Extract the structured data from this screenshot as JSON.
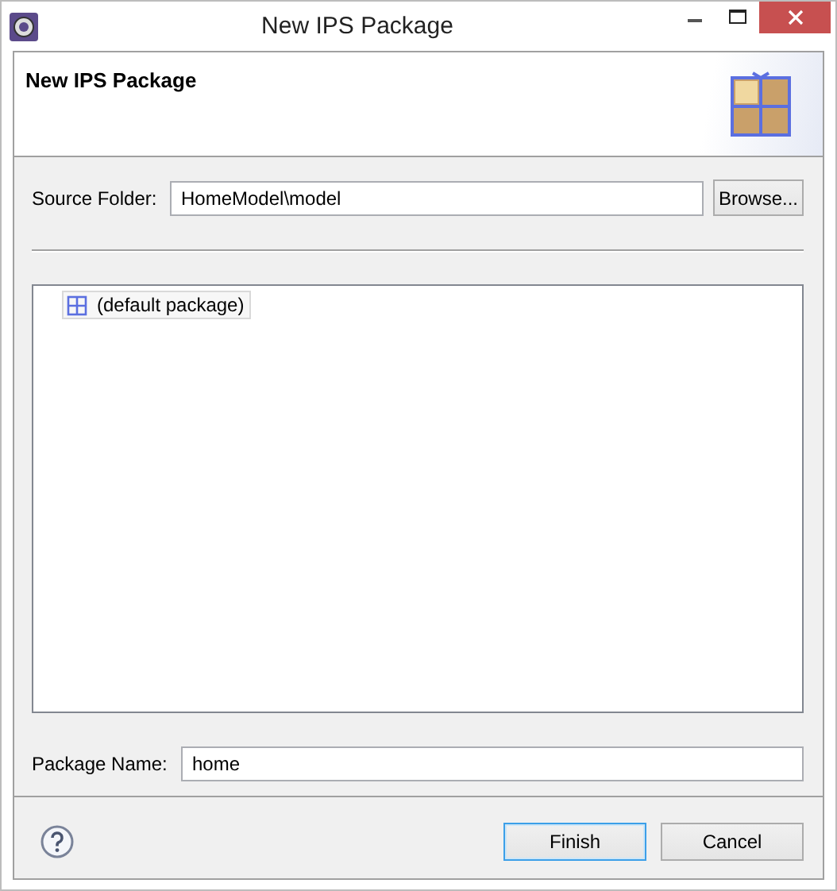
{
  "window": {
    "title": "New IPS Package"
  },
  "banner": {
    "title": "New IPS Package"
  },
  "source_folder": {
    "label": "Source Folder:",
    "value": "HomeModel\\model",
    "button": "Browse..."
  },
  "tree": {
    "items": [
      {
        "label": "(default package)",
        "selected": true
      }
    ]
  },
  "package_name": {
    "label": "Package Name:",
    "value": "home"
  },
  "buttons": [
    {
      "label": "Finish",
      "default": true
    },
    {
      "label": "Cancel",
      "default": false
    }
  ]
}
